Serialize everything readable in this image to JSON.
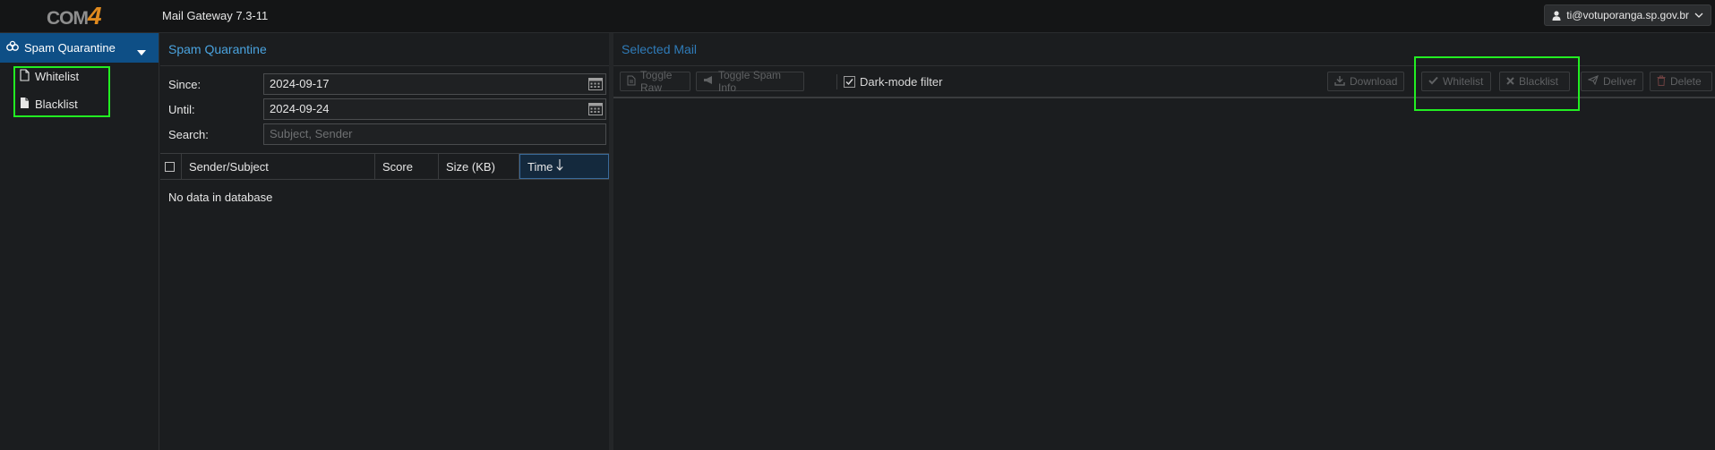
{
  "topbar": {
    "logo_text": "COM",
    "logo_num": "4",
    "app_title": "Mail Gateway 7.3-11",
    "user": "ti@votuporanga.sp.gov.br"
  },
  "sidebar": {
    "header": "Spam Quarantine",
    "items": [
      {
        "label": "Whitelist",
        "icon": "file-outline-icon"
      },
      {
        "label": "Blacklist",
        "icon": "file-solid-icon"
      }
    ]
  },
  "quarantine": {
    "title": "Spam Quarantine",
    "since_label": "Since:",
    "since_value": "2024-09-17",
    "until_label": "Until:",
    "until_value": "2024-09-24",
    "search_label": "Search:",
    "search_placeholder": "Subject, Sender",
    "columns": [
      "Sender/Subject",
      "Score",
      "Size (KB)",
      "Time"
    ],
    "empty_text": "No data in database"
  },
  "selected_mail": {
    "title": "Selected Mail",
    "toolbar": {
      "toggle_raw": "Toggle Raw",
      "toggle_spam_info": "Toggle Spam Info",
      "dark_mode_filter": "Dark-mode filter",
      "download": "Download",
      "whitelist": "Whitelist",
      "blacklist": "Blacklist",
      "deliver": "Deliver",
      "delete": "Delete"
    }
  },
  "colors": {
    "accent": "#0e4f86",
    "title_blue": "#4aa3df",
    "highlight": "#22ee22",
    "logo_orange": "#e08a1e"
  }
}
